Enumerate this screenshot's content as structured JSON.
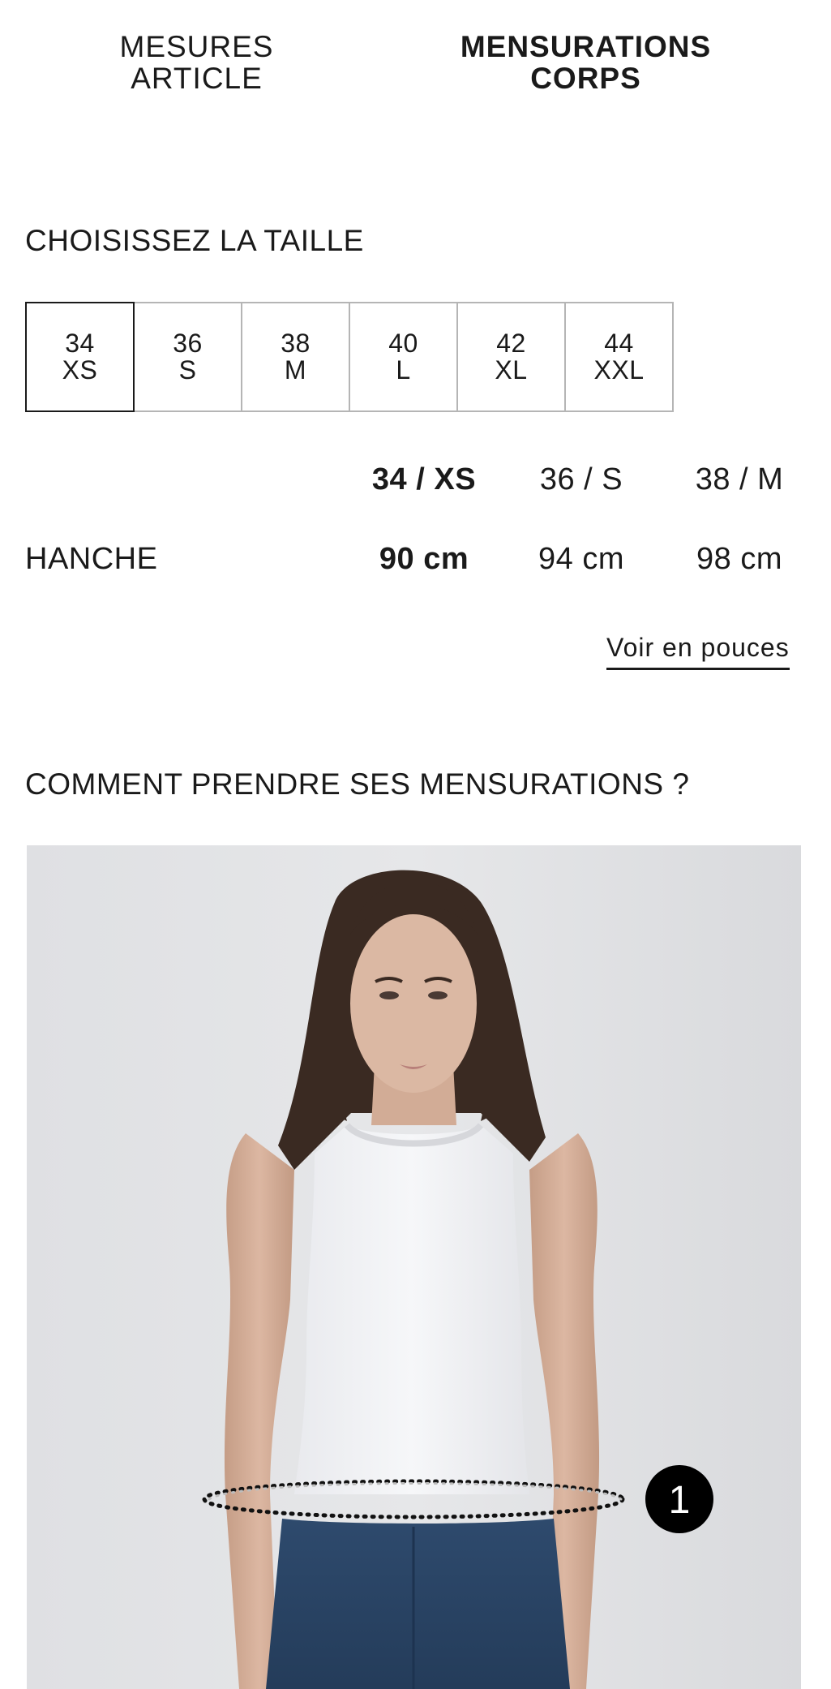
{
  "tabs": {
    "item_measurements": [
      "MESURES",
      "ARTICLE"
    ],
    "body_measurements": [
      "MENSURATIONS",
      "CORPS"
    ]
  },
  "choose_size": {
    "title": "CHOISISSEZ LA TAILLE",
    "sizes": [
      {
        "number": "34",
        "letter": "XS",
        "selected": true
      },
      {
        "number": "36",
        "letter": "S",
        "selected": false
      },
      {
        "number": "38",
        "letter": "M",
        "selected": false
      },
      {
        "number": "40",
        "letter": "L",
        "selected": false
      },
      {
        "number": "42",
        "letter": "XL",
        "selected": false
      },
      {
        "number": "44",
        "letter": "XXL",
        "selected": false
      }
    ]
  },
  "measurements": {
    "columns": [
      "34 / XS",
      "36 / S",
      "38 / M"
    ],
    "rows": [
      {
        "label": "HANCHE",
        "values": [
          "90 cm",
          "94 cm",
          "98 cm"
        ]
      }
    ]
  },
  "inches_link": "Voir en pouces",
  "how_to": {
    "title": "COMMENT PRENDRE SES MENSURATIONS ?",
    "marker_number": "1"
  },
  "colors": {
    "text": "#1a1a1a",
    "border": "#b5b5b5",
    "photo_bg": "#e0e1e4",
    "badge": "#000000"
  }
}
